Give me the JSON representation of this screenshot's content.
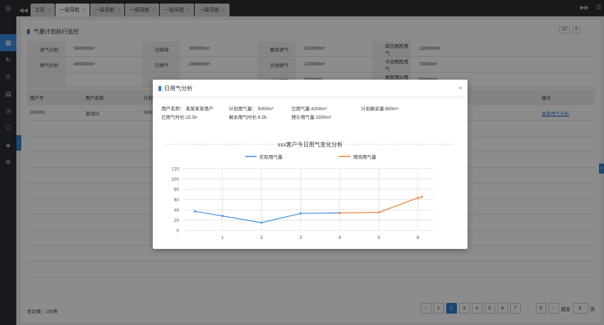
{
  "tabs": [
    {
      "label": "主页",
      "active": false
    },
    {
      "label": "一级导航",
      "active": true
    },
    {
      "label": "一级导航",
      "active": false
    },
    {
      "label": "一级导航",
      "active": false
    },
    {
      "label": "一级导航",
      "active": false
    },
    {
      "label": "一级导航",
      "active": false
    }
  ],
  "page": {
    "title": "气量计划执行监控",
    "page_size": "10",
    "page_size2": "5"
  },
  "info": [
    [
      "进气计划",
      "500000m³",
      "已接收",
      "350000m³",
      "剩余进气",
      "150000m³",
      "前日居民用气",
      "120000m³"
    ],
    [
      "供气计划",
      "400000m³",
      "已供气",
      "280000m³",
      "计划供气",
      "120000m³",
      "今日居民用气",
      "70000m³"
    ],
    [
      "",
      "",
      "",
      "",
      "计划转空",
      "30000m³",
      "居民预计用气",
      "50000m³"
    ]
  ],
  "table": {
    "headers": [
      "用户号",
      "用户名称",
      "计划用",
      "操作"
    ],
    "row": {
      "id": "100001",
      "name": "测试01",
      "value": "5000",
      "action": "查看用气分析"
    }
  },
  "footer": {
    "total": "总记录：100条",
    "pages": [
      "1",
      "2",
      "3",
      "4",
      "5",
      "6",
      "7",
      "...",
      "9"
    ],
    "prev": "‹",
    "next": "›",
    "jump_label": "跳至",
    "jump_value": "8",
    "jump_unit": "页"
  },
  "modal": {
    "title": "日用气分析",
    "user_name": "用户名称：  某某某某用户",
    "planned": "计划用气量：  5000m³",
    "used": "已用气量:4200m³",
    "remain_plan": "计划剩余量:800m³",
    "used_time": "已用气时长:15.5h",
    "remain_time": "剩余用气时长:9.5h",
    "forecast": "预计用气量:1500m³"
  },
  "colors": {
    "actual": "#3a8ee6",
    "forecast": "#f07b2b",
    "accent": "#2f80d1"
  },
  "chart_data": {
    "type": "line",
    "title": "xxx客户今日用气变化分析",
    "x": [
      "1",
      "2",
      "3",
      "4",
      "5",
      "6"
    ],
    "ylim": [
      0,
      120
    ],
    "yticks": [
      "0",
      "20",
      "40",
      "60",
      "80",
      "100",
      "120"
    ],
    "series": [
      {
        "name": "实际用气量",
        "points": [
          [
            0.3,
            37
          ],
          [
            1,
            28
          ],
          [
            2,
            15
          ],
          [
            3,
            33
          ],
          [
            4,
            34
          ]
        ]
      },
      {
        "name": "预测用气量",
        "points": [
          [
            4,
            34
          ],
          [
            5,
            35
          ],
          [
            6,
            63
          ],
          [
            6.1,
            65
          ]
        ]
      }
    ]
  }
}
